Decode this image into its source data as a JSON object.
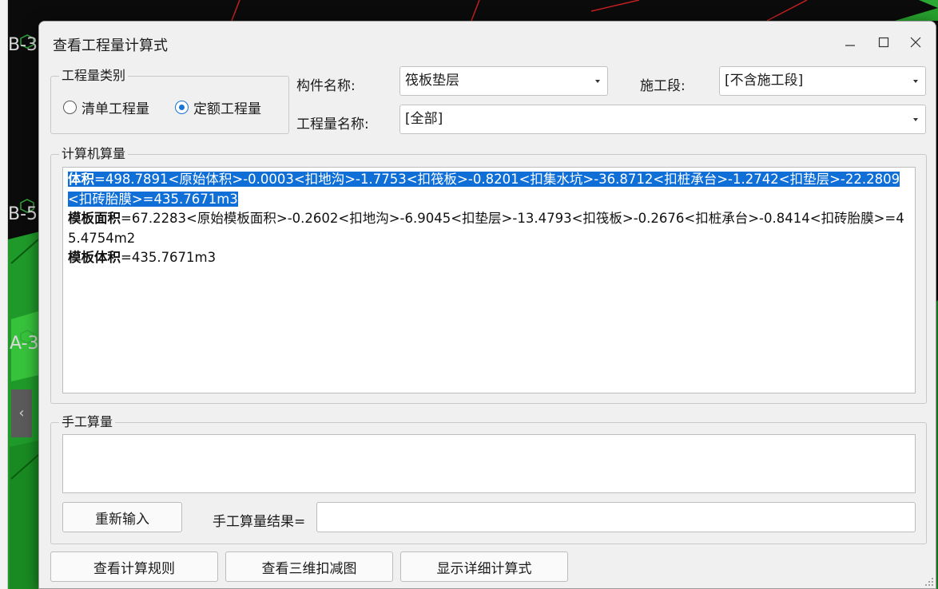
{
  "background": {
    "axis_labels": [
      "B-3",
      "B-5",
      "A-3"
    ],
    "tab_glyph": "‹"
  },
  "dialog": {
    "title": "查看工程量计算式",
    "window_controls": {
      "minimize_icon": "minimize-icon",
      "maximize_icon": "maximize-icon",
      "close_icon": "close-icon"
    },
    "quantity_category": {
      "label": "工程量类别",
      "options": [
        {
          "label": "清单工程量",
          "selected": false
        },
        {
          "label": "定额工程量",
          "selected": true
        }
      ]
    },
    "component_name": {
      "label": "构件名称:",
      "value": "筏板垫层"
    },
    "construction_stage": {
      "label": "施工段:",
      "value": "[不含施工段]"
    },
    "quantity_name": {
      "label": "工程量名称:",
      "value": "[全部]"
    },
    "computer_calc": {
      "label": "计算机算量",
      "lines": [
        {
          "name": "体积",
          "formula": "=498.7891<原始体积>-0.0003<扣地沟>-1.7753<扣筏板>-0.8201<扣集水坑>-36.8712<扣桩承台>-1.2742<扣垫层>-22.2809<扣砖胎膜>=435.7671m3",
          "selected": true
        },
        {
          "name": "模板面积",
          "formula": "=67.2283<原始模板面积>-0.2602<扣地沟>-6.9045<扣垫层>-13.4793<扣筏板>-0.2676<扣桩承台>-0.8414<扣砖胎膜>=45.4754m2",
          "selected": false
        },
        {
          "name": "模板体积",
          "formula": "=435.7671m3",
          "selected": false
        }
      ]
    },
    "manual_calc": {
      "label": "手工算量",
      "reenter_button": "重新输入",
      "result_label": "手工算量结果=",
      "result_value": ""
    },
    "footer_buttons": {
      "view_rules": "查看计算规则",
      "view_3d": "查看三维扣减图",
      "show_detail": "显示详细计算式"
    },
    "colors": {
      "selection": "#0f6fd6",
      "radio_accent": "#1873d3",
      "dialog_bg": "#f0f0f0"
    }
  }
}
